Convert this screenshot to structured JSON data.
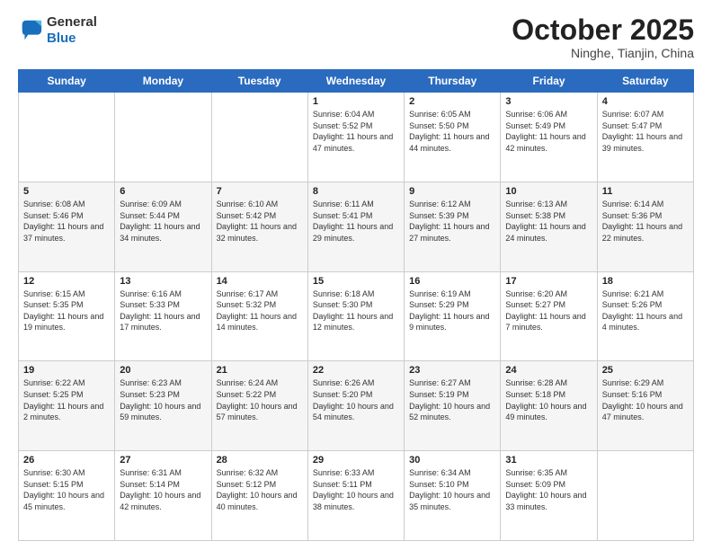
{
  "header": {
    "logo_general": "General",
    "logo_blue": "Blue",
    "month": "October 2025",
    "location": "Ninghe, Tianjin, China"
  },
  "days_of_week": [
    "Sunday",
    "Monday",
    "Tuesday",
    "Wednesday",
    "Thursday",
    "Friday",
    "Saturday"
  ],
  "weeks": [
    [
      {
        "day": "",
        "content": ""
      },
      {
        "day": "",
        "content": ""
      },
      {
        "day": "",
        "content": ""
      },
      {
        "day": "1",
        "content": "Sunrise: 6:04 AM\nSunset: 5:52 PM\nDaylight: 11 hours and 47 minutes."
      },
      {
        "day": "2",
        "content": "Sunrise: 6:05 AM\nSunset: 5:50 PM\nDaylight: 11 hours and 44 minutes."
      },
      {
        "day": "3",
        "content": "Sunrise: 6:06 AM\nSunset: 5:49 PM\nDaylight: 11 hours and 42 minutes."
      },
      {
        "day": "4",
        "content": "Sunrise: 6:07 AM\nSunset: 5:47 PM\nDaylight: 11 hours and 39 minutes."
      }
    ],
    [
      {
        "day": "5",
        "content": "Sunrise: 6:08 AM\nSunset: 5:46 PM\nDaylight: 11 hours and 37 minutes."
      },
      {
        "day": "6",
        "content": "Sunrise: 6:09 AM\nSunset: 5:44 PM\nDaylight: 11 hours and 34 minutes."
      },
      {
        "day": "7",
        "content": "Sunrise: 6:10 AM\nSunset: 5:42 PM\nDaylight: 11 hours and 32 minutes."
      },
      {
        "day": "8",
        "content": "Sunrise: 6:11 AM\nSunset: 5:41 PM\nDaylight: 11 hours and 29 minutes."
      },
      {
        "day": "9",
        "content": "Sunrise: 6:12 AM\nSunset: 5:39 PM\nDaylight: 11 hours and 27 minutes."
      },
      {
        "day": "10",
        "content": "Sunrise: 6:13 AM\nSunset: 5:38 PM\nDaylight: 11 hours and 24 minutes."
      },
      {
        "day": "11",
        "content": "Sunrise: 6:14 AM\nSunset: 5:36 PM\nDaylight: 11 hours and 22 minutes."
      }
    ],
    [
      {
        "day": "12",
        "content": "Sunrise: 6:15 AM\nSunset: 5:35 PM\nDaylight: 11 hours and 19 minutes."
      },
      {
        "day": "13",
        "content": "Sunrise: 6:16 AM\nSunset: 5:33 PM\nDaylight: 11 hours and 17 minutes."
      },
      {
        "day": "14",
        "content": "Sunrise: 6:17 AM\nSunset: 5:32 PM\nDaylight: 11 hours and 14 minutes."
      },
      {
        "day": "15",
        "content": "Sunrise: 6:18 AM\nSunset: 5:30 PM\nDaylight: 11 hours and 12 minutes."
      },
      {
        "day": "16",
        "content": "Sunrise: 6:19 AM\nSunset: 5:29 PM\nDaylight: 11 hours and 9 minutes."
      },
      {
        "day": "17",
        "content": "Sunrise: 6:20 AM\nSunset: 5:27 PM\nDaylight: 11 hours and 7 minutes."
      },
      {
        "day": "18",
        "content": "Sunrise: 6:21 AM\nSunset: 5:26 PM\nDaylight: 11 hours and 4 minutes."
      }
    ],
    [
      {
        "day": "19",
        "content": "Sunrise: 6:22 AM\nSunset: 5:25 PM\nDaylight: 11 hours and 2 minutes."
      },
      {
        "day": "20",
        "content": "Sunrise: 6:23 AM\nSunset: 5:23 PM\nDaylight: 10 hours and 59 minutes."
      },
      {
        "day": "21",
        "content": "Sunrise: 6:24 AM\nSunset: 5:22 PM\nDaylight: 10 hours and 57 minutes."
      },
      {
        "day": "22",
        "content": "Sunrise: 6:26 AM\nSunset: 5:20 PM\nDaylight: 10 hours and 54 minutes."
      },
      {
        "day": "23",
        "content": "Sunrise: 6:27 AM\nSunset: 5:19 PM\nDaylight: 10 hours and 52 minutes."
      },
      {
        "day": "24",
        "content": "Sunrise: 6:28 AM\nSunset: 5:18 PM\nDaylight: 10 hours and 49 minutes."
      },
      {
        "day": "25",
        "content": "Sunrise: 6:29 AM\nSunset: 5:16 PM\nDaylight: 10 hours and 47 minutes."
      }
    ],
    [
      {
        "day": "26",
        "content": "Sunrise: 6:30 AM\nSunset: 5:15 PM\nDaylight: 10 hours and 45 minutes."
      },
      {
        "day": "27",
        "content": "Sunrise: 6:31 AM\nSunset: 5:14 PM\nDaylight: 10 hours and 42 minutes."
      },
      {
        "day": "28",
        "content": "Sunrise: 6:32 AM\nSunset: 5:12 PM\nDaylight: 10 hours and 40 minutes."
      },
      {
        "day": "29",
        "content": "Sunrise: 6:33 AM\nSunset: 5:11 PM\nDaylight: 10 hours and 38 minutes."
      },
      {
        "day": "30",
        "content": "Sunrise: 6:34 AM\nSunset: 5:10 PM\nDaylight: 10 hours and 35 minutes."
      },
      {
        "day": "31",
        "content": "Sunrise: 6:35 AM\nSunset: 5:09 PM\nDaylight: 10 hours and 33 minutes."
      },
      {
        "day": "",
        "content": ""
      }
    ]
  ]
}
